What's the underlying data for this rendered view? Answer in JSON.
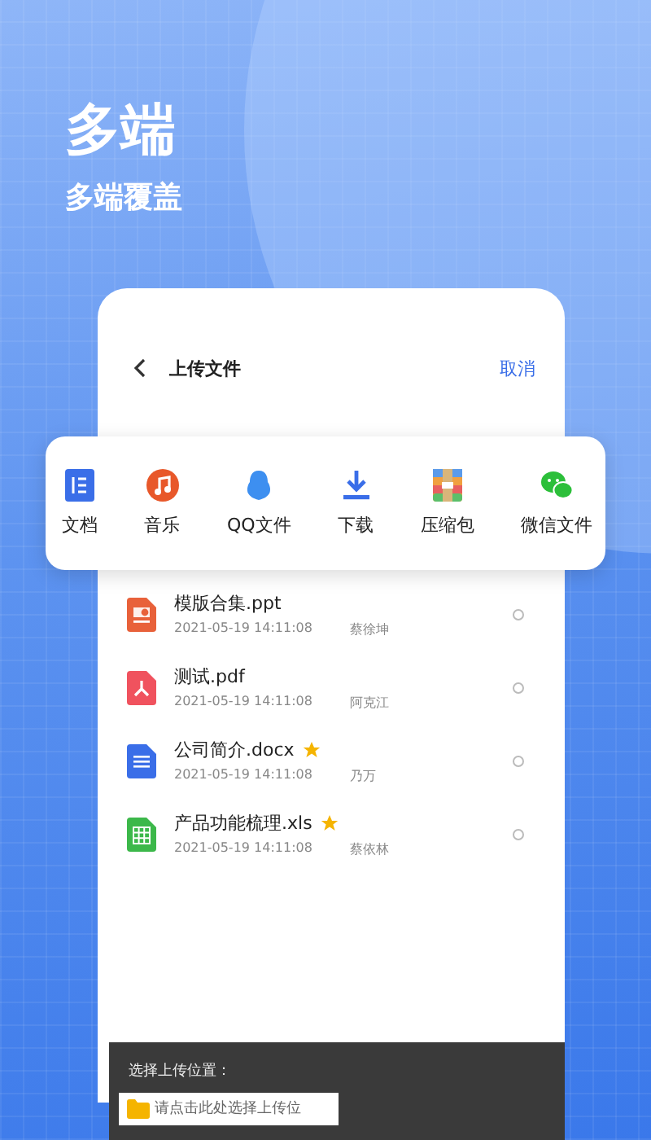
{
  "hero": {
    "title": "多端",
    "subtitle": "多端覆盖"
  },
  "header": {
    "title": "上传文件",
    "action": "取消"
  },
  "sources": [
    {
      "kind": "docs",
      "label": "文档"
    },
    {
      "kind": "music",
      "label": "音乐"
    },
    {
      "kind": "qq",
      "label": "QQ文件"
    },
    {
      "kind": "download",
      "label": "下载"
    },
    {
      "kind": "archive",
      "label": "压缩包"
    },
    {
      "kind": "wechat",
      "label": "微信文件"
    }
  ],
  "files": [
    {
      "kind": "ppt",
      "name": "模版合集.ppt",
      "date": "2021-05-19 14:11:08",
      "owner": "蔡徐坤",
      "starred": false,
      "selected": false
    },
    {
      "kind": "pdf",
      "name": "测试.pdf",
      "date": "2021-05-19 14:11:08",
      "owner": "阿克江",
      "starred": false,
      "selected": false
    },
    {
      "kind": "doc",
      "name": "公司简介.docx",
      "date": "2021-05-19 14:11:08",
      "owner": "乃万",
      "starred": true,
      "selected": false
    },
    {
      "kind": "xls",
      "name": "产品功能梳理.xls",
      "date": "2021-05-19 14:11:08",
      "owner": "蔡依林",
      "starred": true,
      "selected": false
    }
  ],
  "location": {
    "label": "选择上传位置：",
    "placeholder": "请点击此处选择上传位"
  }
}
